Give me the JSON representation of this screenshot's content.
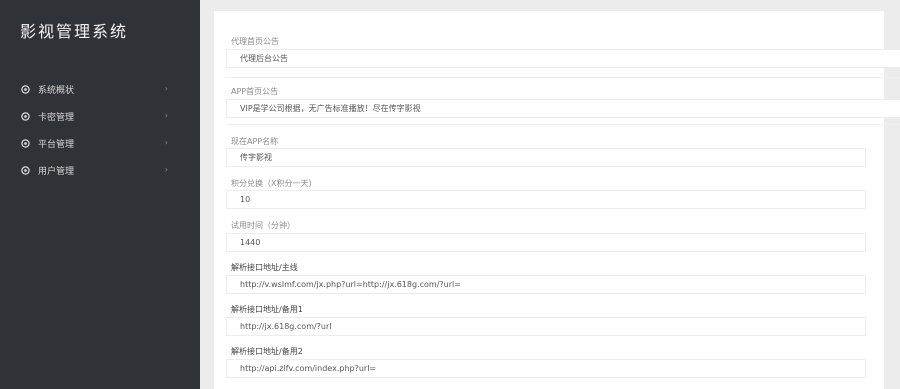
{
  "app": {
    "title": "影视管理系统"
  },
  "sidebar": {
    "items": [
      {
        "label": "系统概状",
        "icon": "dashboard-icon"
      },
      {
        "label": "卡密管理",
        "icon": "card-icon"
      },
      {
        "label": "平台管理",
        "icon": "platform-icon"
      },
      {
        "label": "用户管理",
        "icon": "user-icon"
      }
    ]
  },
  "form": {
    "fields": [
      {
        "label": "代理首页公告",
        "value": "代理后台公告"
      },
      {
        "label": "APP首页公告",
        "value": "VIP是学公司根据，无广告标准播放！尽在传字影视"
      },
      {
        "label": "现在APP名称",
        "value": "传字影视"
      },
      {
        "label": "积分兑换（X积分一天）",
        "value": "10"
      },
      {
        "label": "试用时间（分钟）",
        "value": "1440"
      },
      {
        "label": "解析接口地址/主线",
        "value": "http://v.wslmf.com/jx.php?url=http://jx.618g.com/?url="
      },
      {
        "label": "解析接口地址/备用1",
        "value": "http://jx.618g.com/?url"
      },
      {
        "label": "解析接口地址/备用2",
        "value": "http://api.zlfv.com/index.php?url="
      }
    ]
  }
}
